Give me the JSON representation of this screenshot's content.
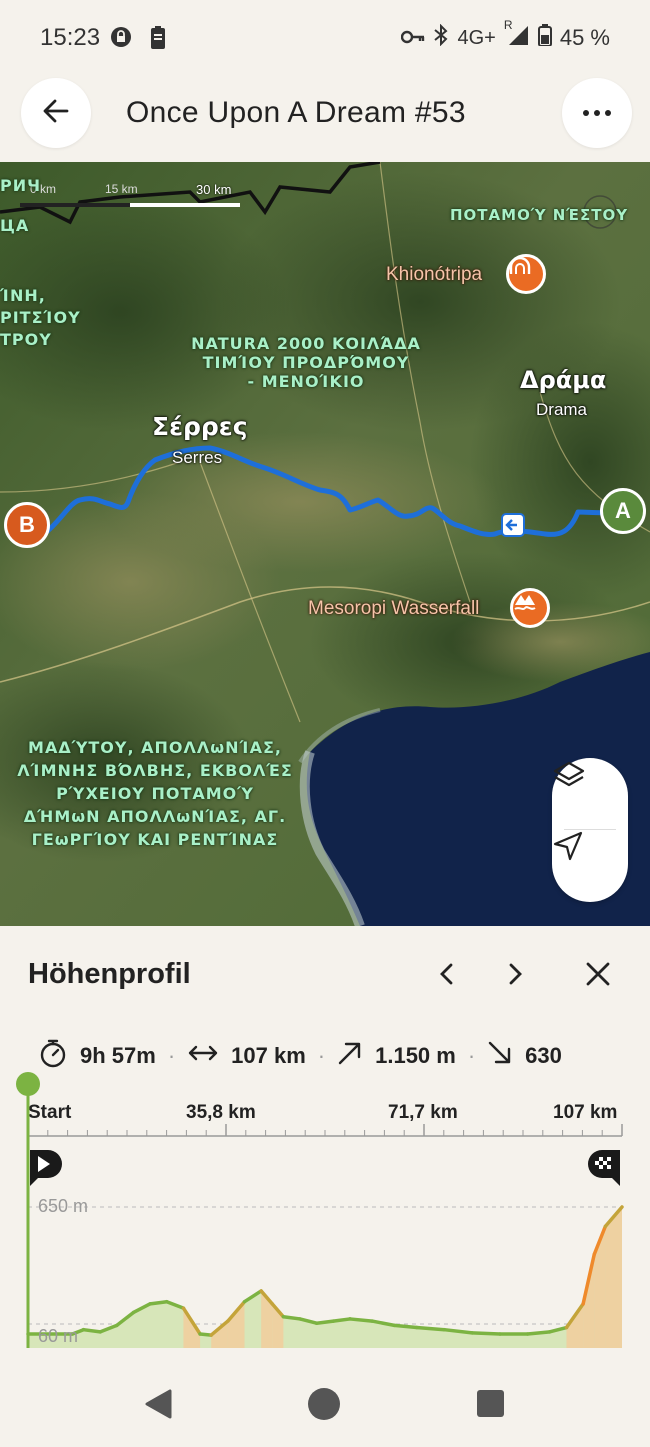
{
  "status_bar": {
    "time": "15:23",
    "network": "4G+",
    "roaming": "R",
    "battery": "45 %"
  },
  "header": {
    "title": "Once Upon A Dream #53",
    "back_icon": "arrow-left-icon",
    "more_icon": "more-dots-icon"
  },
  "map": {
    "scale": {
      "label_0": "0 km",
      "label_mid": "15 km",
      "label_end": "30 km"
    },
    "labels": {
      "top_left_1": "РИЧ",
      "top_left_2": "ЦА",
      "left_region_1": "ΊΝΗ,",
      "left_region_2": "ΡΙΤΣΊΟΥ",
      "left_region_3": "ΤΡΟΥ",
      "river_nestou": "ΠΟΤΑΜΟΎ ΝΈΣΤΟΥ",
      "natura_1": "NATURA 2000 ΚΟΙΛΆΔΑ",
      "natura_2": "ΤΙΜΊΟΥ ΠΡΟΔΡΌΜΟΥ",
      "natura_3": "- ΜΕΝΟΊΚΙΟ",
      "madytos_1": "ΜΑΔΎΤΟΥ, ΑΠΟΛΛωΝΊΑΣ,",
      "madytos_2": "ΛΊΜΝΗΣ ΒΌΛΒΗΣ, ΕΚΒΟΛΈΣ",
      "madytos_3": "ΡΎΧΕΙΟΥ ΠΟΤΑΜΟΎ",
      "madytos_4": "ΔΉΜωΝ ΑΠΟΛΛωΝΊΑΣ, ΑΓ.",
      "madytos_5": "ΓΕωΡΓΊΟΥ ΚΑΙ ΡΕΝΤΊΝΑΣ"
    },
    "cities": {
      "serres_greek": "Σέρρες",
      "serres_latin": "Serres",
      "drama_greek": "Δράμα",
      "drama_latin": "Drama"
    },
    "pois": {
      "khionotripa": "Khionótripa",
      "mesoropi": "Mesoropi Wasserfall"
    },
    "markers": {
      "start": "A",
      "end": "B"
    },
    "controls": {
      "layers_icon": "layers-icon",
      "locate_icon": "navigation-arrow-icon"
    }
  },
  "elevation_panel": {
    "title": "Höhenprofil",
    "prev_icon": "chevron-left-icon",
    "next_icon": "chevron-right-icon",
    "close_icon": "close-icon",
    "stats": {
      "duration": "9h 57m",
      "distance": "107 km",
      "ascent": "1.150 m",
      "descent": "630"
    },
    "axis": {
      "tick_labels": [
        "Start",
        "35,8 km",
        "71,7 km",
        "107 km"
      ],
      "y_max_label": "650 m",
      "y_min_label": "60 m"
    }
  },
  "chart_data": {
    "type": "area",
    "title": "Höhenprofil",
    "xlabel": "",
    "ylabel": "",
    "x_unit": "km",
    "y_unit": "m",
    "xlim": [
      0,
      107
    ],
    "ylim": [
      60,
      650
    ],
    "x": [
      0,
      4,
      8,
      10,
      13,
      16,
      19,
      22,
      25,
      28,
      31,
      33,
      36,
      39,
      42,
      44,
      46,
      49,
      52,
      55,
      58,
      62,
      66,
      70,
      75,
      80,
      85,
      90,
      94,
      97,
      100,
      102,
      104,
      107
    ],
    "y": [
      60,
      60,
      60,
      80,
      70,
      100,
      160,
      200,
      210,
      180,
      60,
      55,
      120,
      210,
      260,
      200,
      140,
      130,
      110,
      120,
      130,
      120,
      100,
      90,
      80,
      65,
      60,
      60,
      70,
      90,
      200,
      430,
      560,
      650
    ]
  },
  "nav_bar": {
    "back_icon": "nav-back-icon",
    "home_icon": "nav-home-icon",
    "recents_icon": "nav-recents-icon"
  }
}
